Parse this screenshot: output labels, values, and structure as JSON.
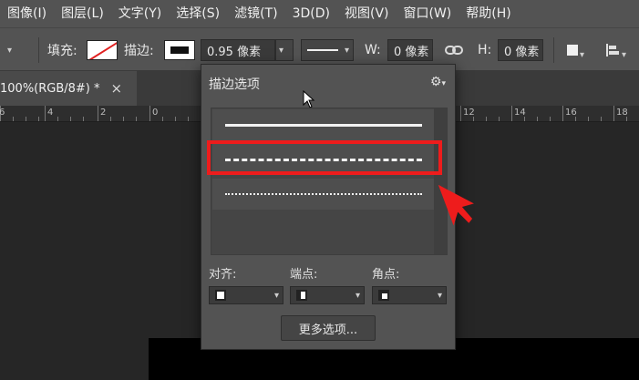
{
  "menubar": {
    "items": [
      "图像(I)",
      "图层(L)",
      "文字(Y)",
      "选择(S)",
      "滤镜(T)",
      "3D(D)",
      "视图(V)",
      "窗口(W)",
      "帮助(H)"
    ]
  },
  "options_bar": {
    "fill_label": "填充:",
    "stroke_label": "描边:",
    "stroke_width": "0.95 像素",
    "w_label": "W:",
    "w_value": "0 像素",
    "h_label": "H:",
    "h_value": "0 像素"
  },
  "tab": {
    "title": "100%(RGB/8#) *",
    "close": "×"
  },
  "ruler": {
    "labels": [
      "6",
      "4",
      "2",
      "0",
      "12",
      "14",
      "16",
      "18"
    ]
  },
  "stroke_popup": {
    "title": "描边选项",
    "styles": [
      "solid",
      "dashed",
      "dotted"
    ],
    "selected_style": "dashed",
    "align_label": "对齐:",
    "caps_label": "端点:",
    "corners_label": "角点:",
    "more_button": "更多选项..."
  },
  "colors": {
    "highlight": "#ee1c1c",
    "arrow": "#ee1c1c",
    "panel": "#535353"
  },
  "icons": [
    "gear-icon",
    "chevron-down-icon",
    "link-icon",
    "mouse-cursor-icon",
    "red-pointer-arrow-icon"
  ]
}
